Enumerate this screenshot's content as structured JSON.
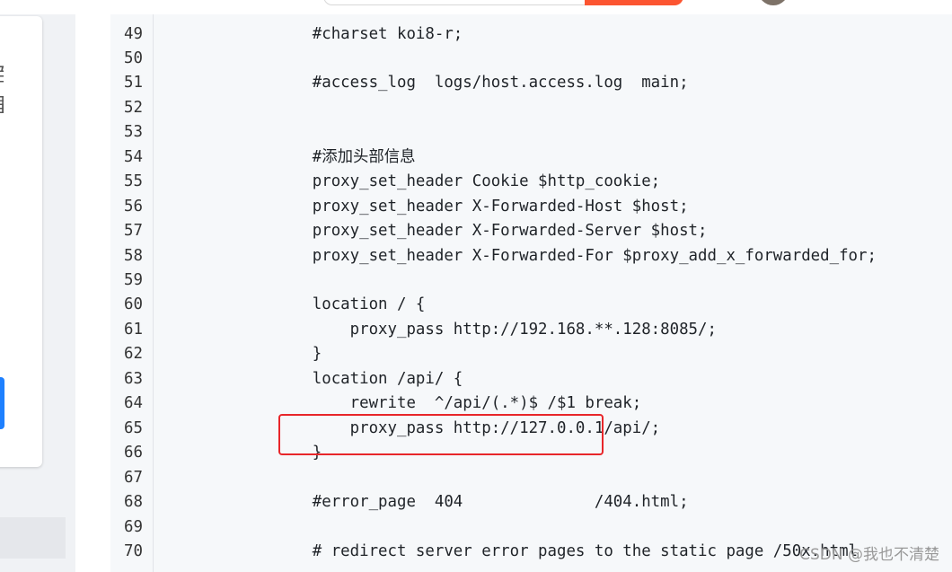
{
  "code": {
    "lines": [
      {
        "num": "49",
        "text": "        #charset koi8-r;"
      },
      {
        "num": "50",
        "text": ""
      },
      {
        "num": "51",
        "text": "        #access_log  logs/host.access.log  main;"
      },
      {
        "num": "52",
        "text": ""
      },
      {
        "num": "53",
        "text": ""
      },
      {
        "num": "54",
        "text": "        #添加头部信息"
      },
      {
        "num": "55",
        "text": "        proxy_set_header Cookie $http_cookie;"
      },
      {
        "num": "56",
        "text": "        proxy_set_header X-Forwarded-Host $host;"
      },
      {
        "num": "57",
        "text": "        proxy_set_header X-Forwarded-Server $host;"
      },
      {
        "num": "58",
        "text": "        proxy_set_header X-Forwarded-For $proxy_add_x_forwarded_for;"
      },
      {
        "num": "59",
        "text": ""
      },
      {
        "num": "60",
        "text": "        location / {"
      },
      {
        "num": "61",
        "text": "            proxy_pass http://192.168.**.128:8085/;"
      },
      {
        "num": "62",
        "text": "        }"
      },
      {
        "num": "63",
        "text": "        location /api/ {"
      },
      {
        "num": "64",
        "text": "            rewrite  ^/api/(.*)$ /$1 break;"
      },
      {
        "num": "65",
        "text": "            proxy_pass http://127.0.0.1/api/;"
      },
      {
        "num": "66",
        "text": "        }"
      },
      {
        "num": "67",
        "text": ""
      },
      {
        "num": "68",
        "text": "        #error_page  404              /404.html;"
      },
      {
        "num": "69",
        "text": ""
      },
      {
        "num": "70",
        "text": "        # redirect server error pages to the static page /50x.html"
      }
    ]
  },
  "sidebar": {
    "glyphs": "百 里"
  },
  "watermark": "CSDN @我也不清楚",
  "colors": {
    "accent": "#fc5531",
    "highlight": "#e8262a",
    "blue_button": "#1e80ff"
  }
}
